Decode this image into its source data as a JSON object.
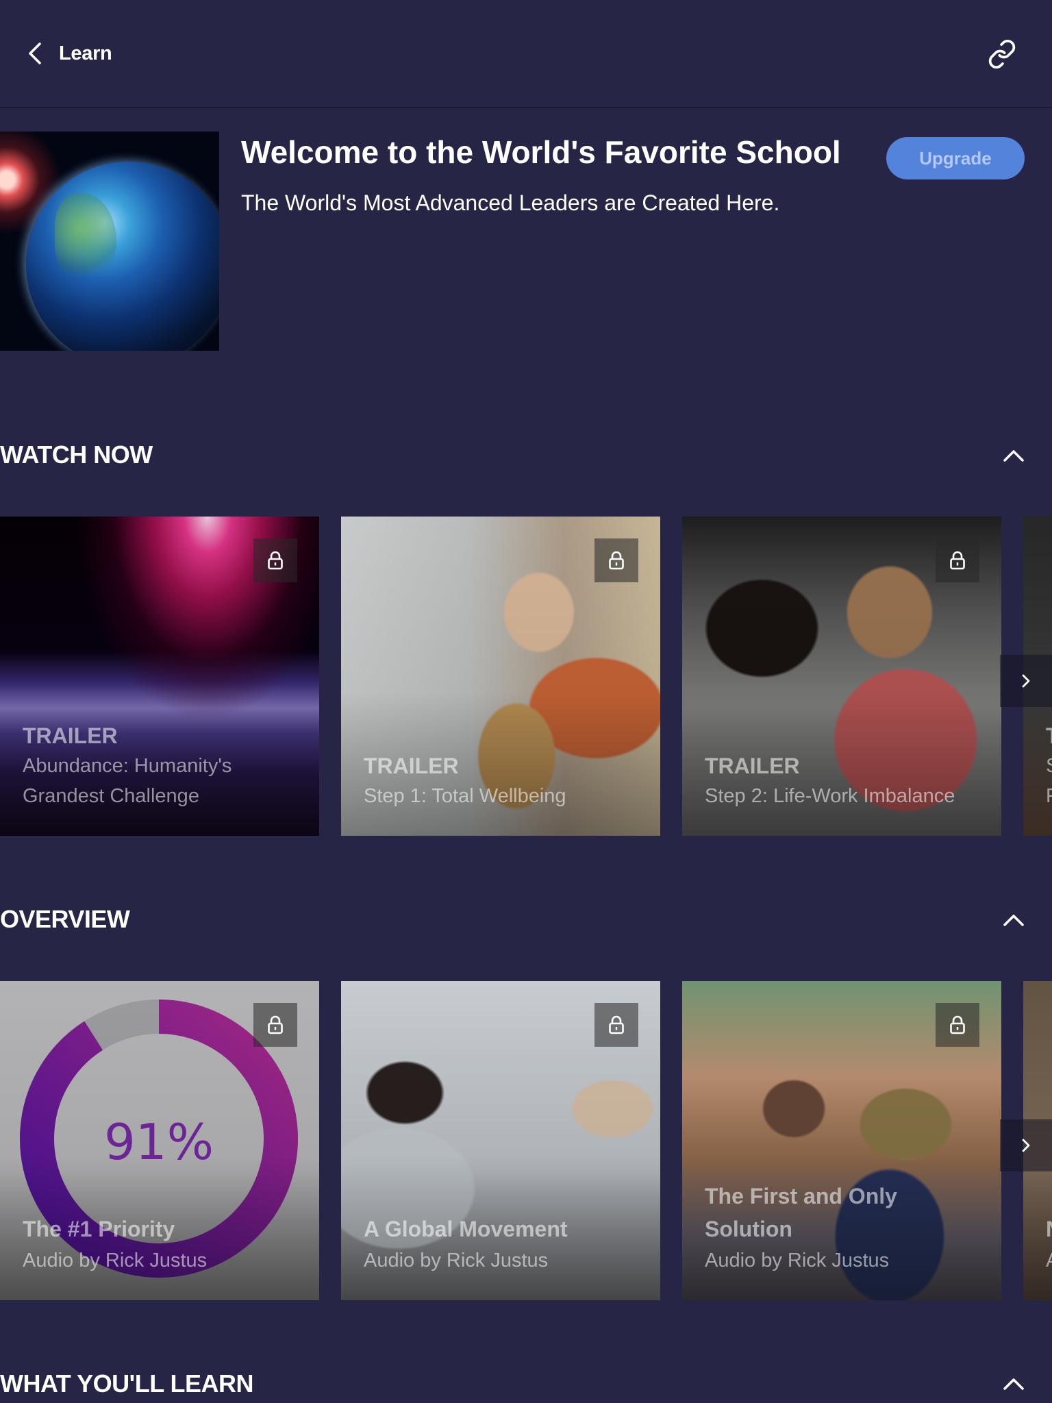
{
  "header": {
    "back_label": "Learn",
    "back_icon": "chevron-left-icon",
    "share_icon": "link-icon"
  },
  "hero": {
    "image_alt": "Earth from space",
    "title": "Welcome to the World's Favorite School",
    "subtitle": "The World's Most Advanced Leaders are Created Here.",
    "upgrade_label": "Upgrade",
    "upgrade_color": "#5483db"
  },
  "sections": [
    {
      "heading": "WATCH NOW",
      "expanded": true,
      "cards": [
        {
          "kicker": "TRAILER",
          "title": "Abundance: Humanity's Grandest Challenge",
          "locked": true
        },
        {
          "kicker": "TRAILER",
          "title": "Step 1: Total Wellbeing",
          "locked": true
        },
        {
          "kicker": "TRAILER",
          "title": "Step 2: Life-Work Imbalance",
          "locked": true
        },
        {
          "kicker": "T",
          "title": "S",
          "title_line2": "F",
          "locked": true
        }
      ]
    },
    {
      "heading": "OVERVIEW",
      "expanded": true,
      "cards": [
        {
          "title": "The #1 Priority",
          "subtitle": "Audio by Rick Justus",
          "locked": true,
          "donut_value": "91%",
          "donut_percent": 91
        },
        {
          "title": "A Global Movement",
          "subtitle": "Audio by Rick Justus",
          "locked": true
        },
        {
          "title": "The First and Only Solution",
          "subtitle": "Audio by Rick Justus",
          "locked": true
        },
        {
          "title": "N",
          "subtitle": "A",
          "locked": true
        }
      ]
    },
    {
      "heading": "WHAT YOU'LL LEARN",
      "expanded": true
    }
  ],
  "colors": {
    "background": "#262545",
    "upgrade_text": "#b3c8f2",
    "donut_start": "#b02a90",
    "donut_end": "#4a12a0",
    "donut_rest": "#a8a8ac",
    "donut_label": "#7a2aa8"
  }
}
